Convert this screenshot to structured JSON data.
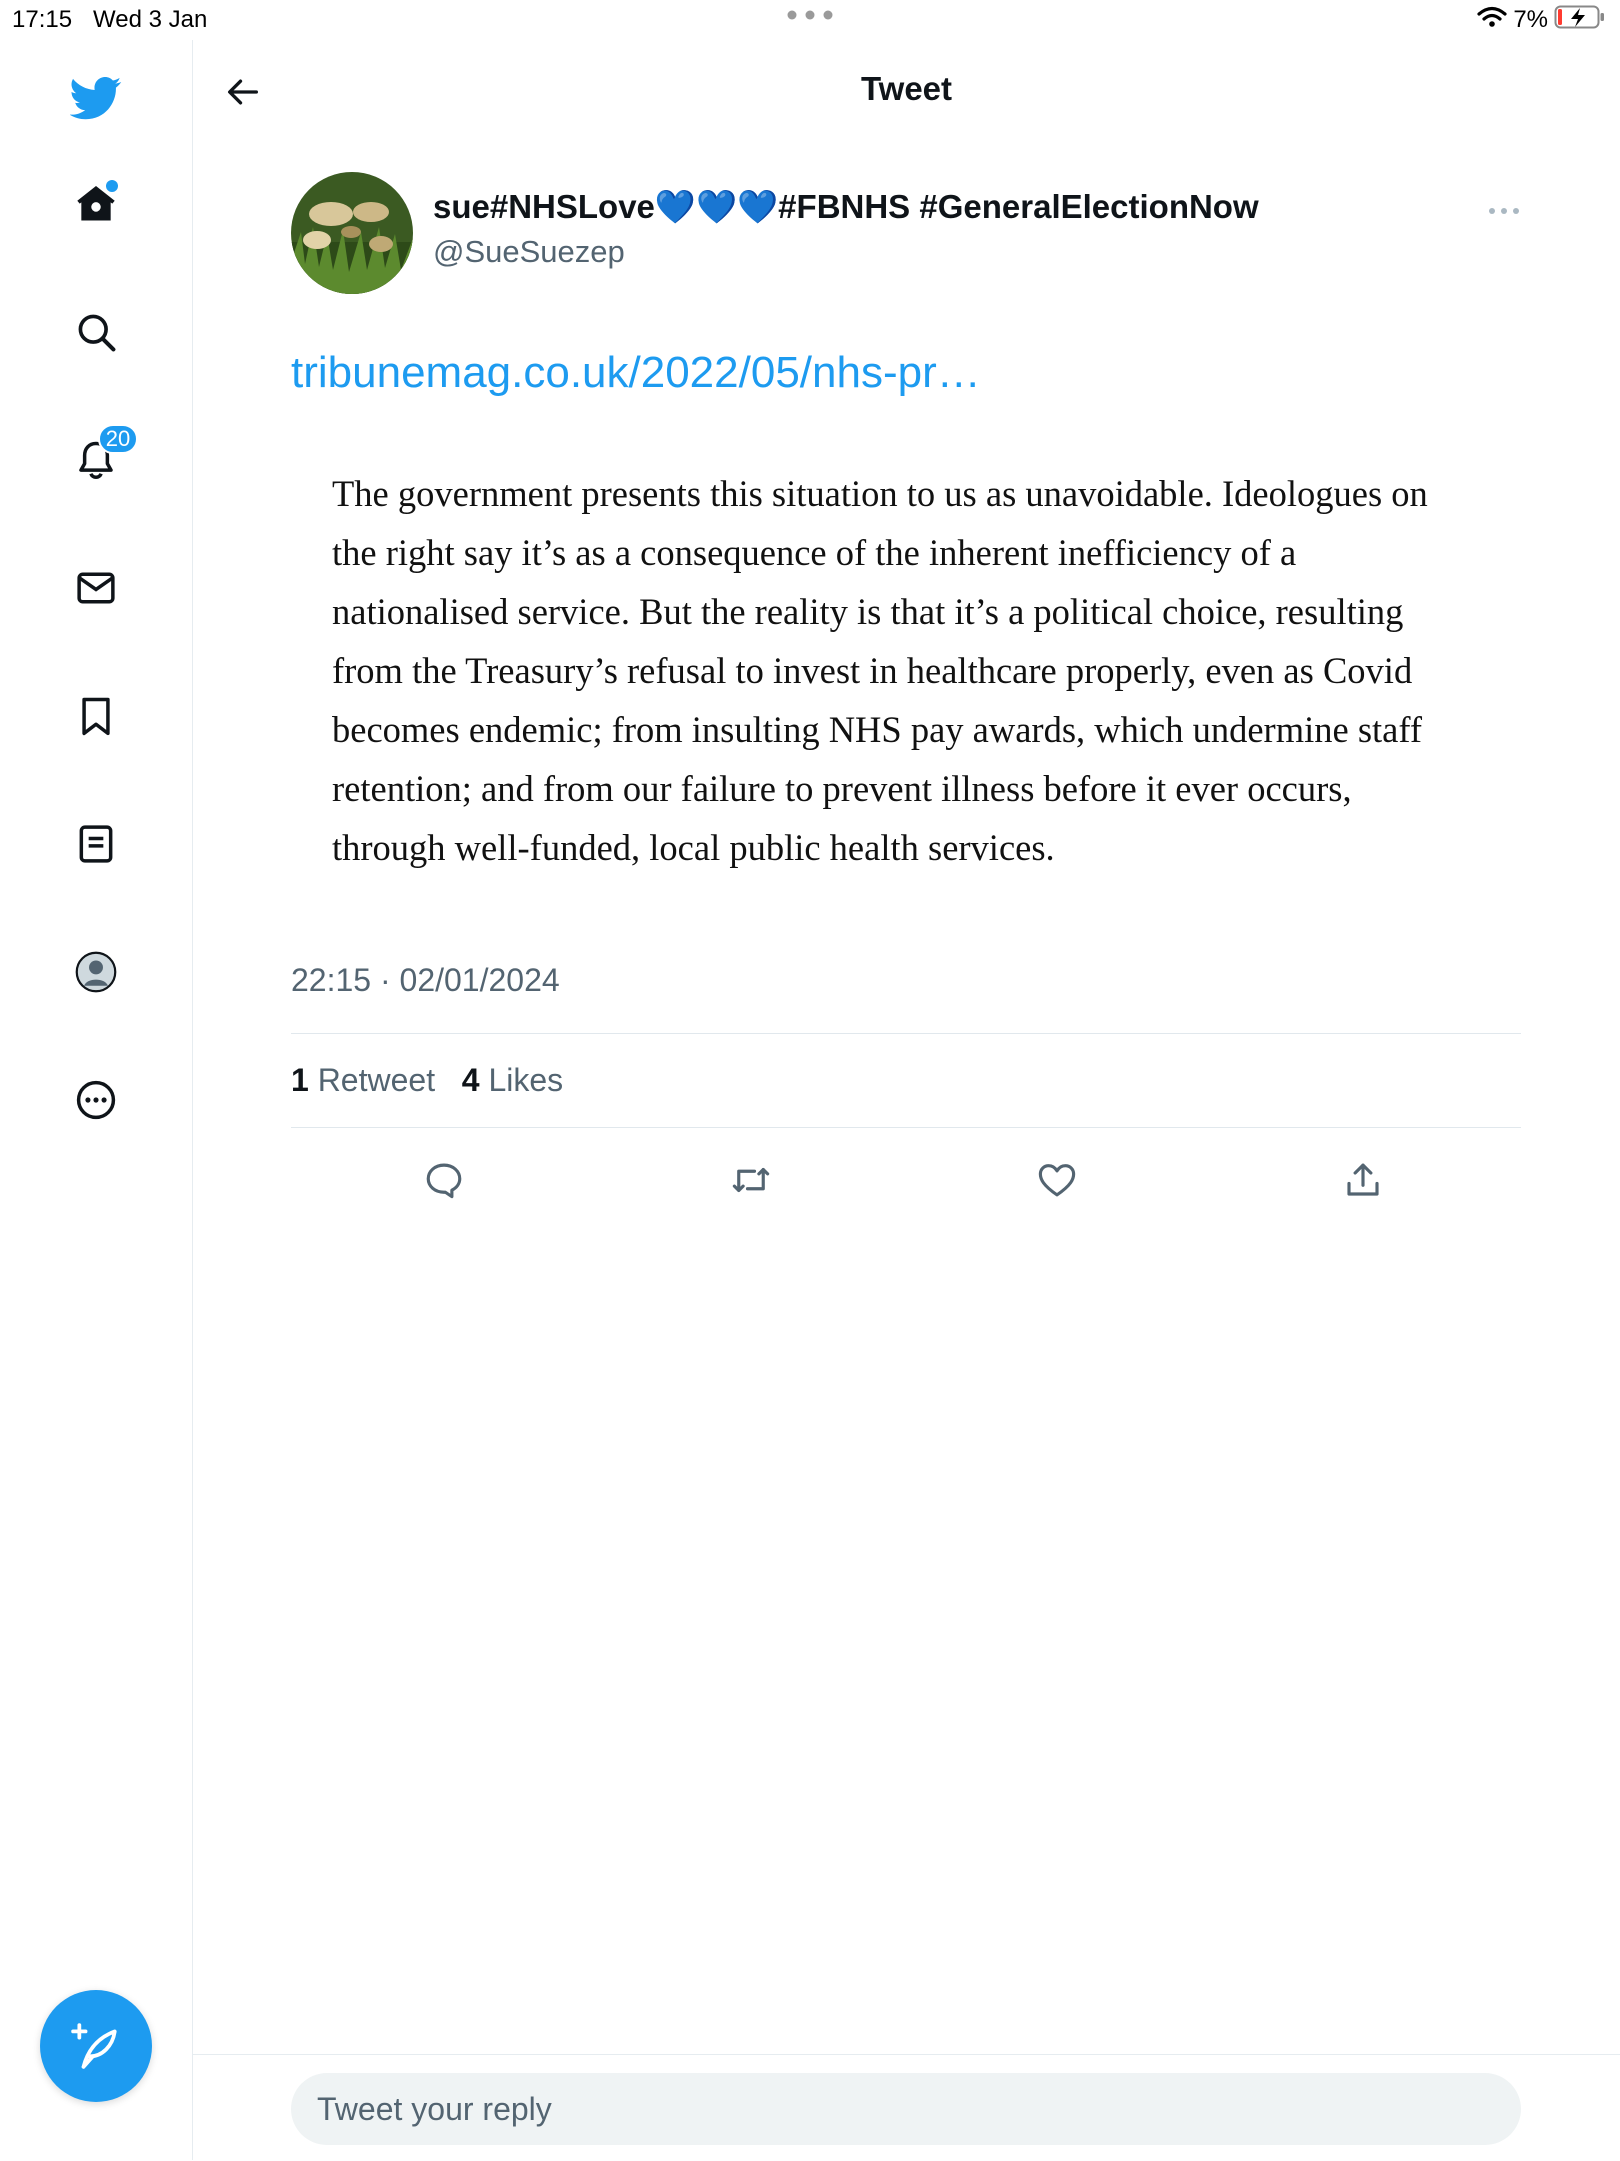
{
  "status_bar": {
    "time": "17:15",
    "date": "Wed 3 Jan",
    "battery": "7%"
  },
  "sidebar": {
    "notifications_count": "20",
    "items": [
      {
        "name": "home",
        "icon": "home-icon"
      },
      {
        "name": "explore",
        "icon": "search-icon"
      },
      {
        "name": "notifications",
        "icon": "bell-icon"
      },
      {
        "name": "messages",
        "icon": "mail-icon"
      },
      {
        "name": "bookmarks",
        "icon": "bookmark-icon"
      },
      {
        "name": "lists",
        "icon": "list-icon"
      },
      {
        "name": "profile",
        "icon": "profile-icon"
      },
      {
        "name": "more",
        "icon": "more-circle-icon"
      }
    ]
  },
  "header": {
    "title": "Tweet"
  },
  "tweet": {
    "display_name": "sue#NHSLove💙💙💙#FBNHS #GeneralElectionNow",
    "handle": "@SueSuezep",
    "link": "tribunemag.co.uk/2022/05/nhs-pr…",
    "quote_text": "The government presents this situation to us as unavoidable. Ideologues on the right say it’s as a consequence of the inherent inefficiency of a nationalised service. But the reality is that it’s a political choice, resulting from the Treasury’s refusal to invest in healthcare properly, even as Covid becomes endemic; from insulting NHS pay awards, which undermine staff retention; and from our failure to prevent illness before it ever occurs, through well-funded, local public health services.",
    "timestamp": "22:15 · 02/01/2024",
    "retweet_count": "1",
    "retweet_label": "Retweet",
    "like_count": "4",
    "like_label": "Likes"
  },
  "reply": {
    "placeholder": "Tweet your reply"
  },
  "colors": {
    "accent": "#1d9bf0",
    "text_primary": "#0f1419",
    "text_secondary": "#536471",
    "divider": "#e1e8ed"
  }
}
